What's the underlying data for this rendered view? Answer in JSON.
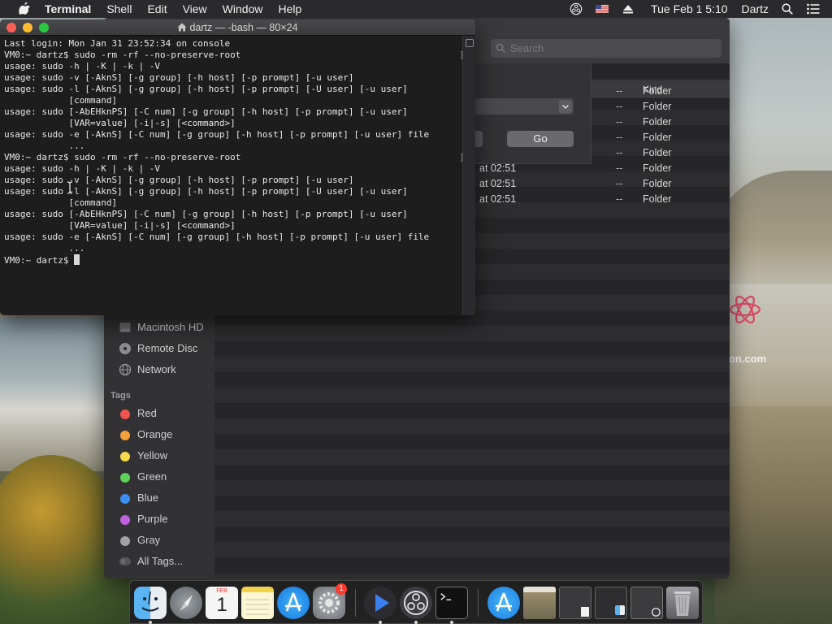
{
  "menubar": {
    "app_name": "Terminal",
    "menus": [
      "Shell",
      "Edit",
      "View",
      "Window",
      "Help"
    ],
    "clock": "Tue Feb 1  5:10",
    "user": "Dartz"
  },
  "terminal": {
    "title": "dartz — -bash — 80×24",
    "lines": [
      "Last login: Mon Jan 31 23:52:34 on console",
      "VM0:~ dartz$ sudo -rm -rf --no-preserve-root",
      "usage: sudo -h | -K | -k | -V",
      "usage: sudo -v [-AknS] [-g group] [-h host] [-p prompt] [-u user]",
      "usage: sudo -l [-AknS] [-g group] [-h host] [-p prompt] [-U user] [-u user]",
      "            [command]",
      "usage: sudo [-AbEHknPS] [-C num] [-g group] [-h host] [-p prompt] [-u user]",
      "            [VAR=value] [-i|-s] [<command>]",
      "usage: sudo -e [-AknS] [-C num] [-g group] [-h host] [-p prompt] [-u user] file",
      "            ...",
      "VM0:~ dartz$ sudo -rm -rf --no-preserve-root",
      "usage: sudo -h | -K | -k | -V",
      "usage: sudo -v [-AknS] [-g group] [-h host] [-p prompt] [-u user]",
      "usage: sudo -l [-AknS] [-g group] [-h host] [-p prompt] [-U user] [-u user]",
      "            [command]",
      "usage: sudo [-AbEHknPS] [-C num] [-g group] [-h host] [-p prompt] [-u user]",
      "            [VAR=value] [-i|-s] [<command>]",
      "usage: sudo -e [-AknS] [-C num] [-g group] [-h host] [-p prompt] [-u user] file",
      "            ...",
      "VM0:~ dartz$ "
    ]
  },
  "finder": {
    "search_placeholder": "Search",
    "column_kind": "Kind",
    "rows": [
      {
        "date": "",
        "size": "--",
        "kind": "Folder"
      },
      {
        "date": "",
        "size": "--",
        "kind": "Folder"
      },
      {
        "date": "",
        "size": "--",
        "kind": "Folder"
      },
      {
        "date": "",
        "size": "--",
        "kind": "Folder"
      },
      {
        "date": "",
        "size": "--",
        "kind": "Folder"
      },
      {
        "date": "at 02:51",
        "size": "--",
        "kind": "Folder"
      },
      {
        "date": "at 02:51",
        "size": "--",
        "kind": "Folder"
      },
      {
        "date": "at 02:51",
        "size": "--",
        "kind": "Folder"
      }
    ],
    "sheet_button": "Go",
    "locations": [
      {
        "label": "Macintosh HD",
        "icon": "disk-icon"
      },
      {
        "label": "Remote Disc",
        "icon": "disc-icon"
      },
      {
        "label": "Network",
        "icon": "globe-icon"
      }
    ],
    "tags_heading": "Tags",
    "tags": [
      {
        "label": "Red",
        "color": "#f0524f"
      },
      {
        "label": "Orange",
        "color": "#f4a13c"
      },
      {
        "label": "Yellow",
        "color": "#f7d94c"
      },
      {
        "label": "Green",
        "color": "#5fd058"
      },
      {
        "label": "Blue",
        "color": "#3b8ff3"
      },
      {
        "label": "Purple",
        "color": "#c061e0"
      },
      {
        "label": "Gray",
        "color": "#a3a3a6"
      }
    ],
    "all_tags": "All Tags..."
  },
  "wallpaper": {
    "watermark": "on.com"
  },
  "dock": {
    "calendar_month": "FEB",
    "calendar_day": "1",
    "badge_count": "1",
    "items": [
      "finder-icon",
      "launchpad-icon",
      "calendar-icon",
      "notes-icon",
      "app-store-icon",
      "system-preferences-icon",
      "quicktime-icon",
      "obs-icon",
      "terminal-icon",
      "installer-icon",
      "preview-icon",
      "screenshot-icon",
      "finder-window-icon",
      "window-icon",
      "trash-icon"
    ]
  }
}
